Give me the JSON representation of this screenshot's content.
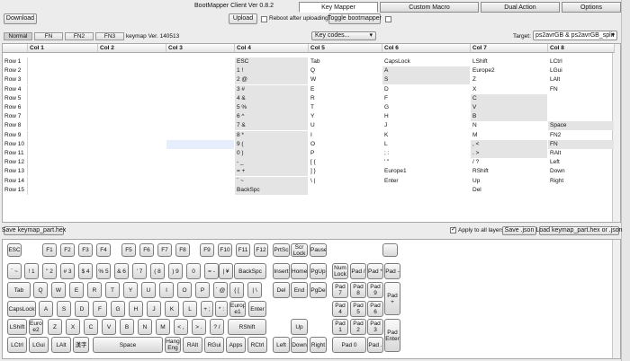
{
  "window": {
    "title": "BootMapper Client Ver 0.8.2"
  },
  "toolbar": {
    "download": "Download",
    "upload": "Upload",
    "reboot_label": "Reboot after uploading",
    "toggle": "Toggle bootmapper"
  },
  "tabs": [
    "Key Mapper",
    "Custom Macro",
    "Dual Action",
    "Options"
  ],
  "active_tab": "Key Mapper",
  "layers": [
    "Normal",
    "FN",
    "FN2",
    "FN3"
  ],
  "keymap_version": "keymap Ver. 140513",
  "keycodes_dropdown": "Key codes...",
  "target": {
    "label": "Target:",
    "value": "ps2avrGB & ps2avrGB_split"
  },
  "grid": {
    "columns": [
      "Col 1",
      "Col 2",
      "Col 3",
      "Col 4",
      "Col 5",
      "Col 6",
      "Col 7",
      "Col 8"
    ],
    "rows": [
      {
        "label": "Row 1",
        "cells": [
          "",
          "",
          "",
          "ESC",
          "Tab",
          "CapsLock",
          "LShift",
          "LCtrl"
        ]
      },
      {
        "label": "Row 2",
        "cells": [
          "",
          "",
          "",
          "1 !",
          "Q",
          "A",
          "Europe2",
          "LGui"
        ]
      },
      {
        "label": "Row 3",
        "cells": [
          "",
          "",
          "",
          "2 @",
          "W",
          "S",
          "Z",
          "LAlt"
        ]
      },
      {
        "label": "Row 4",
        "cells": [
          "",
          "",
          "",
          "3 #",
          "E",
          "D",
          "X",
          "FN"
        ]
      },
      {
        "label": "Row 5",
        "cells": [
          "",
          "",
          "",
          "4 &",
          "R",
          "F",
          "C",
          ""
        ]
      },
      {
        "label": "Row 6",
        "cells": [
          "",
          "",
          "",
          "5 %",
          "T",
          "G",
          "V",
          ""
        ]
      },
      {
        "label": "Row 7",
        "cells": [
          "",
          "",
          "",
          "6 ^",
          "Y",
          "H",
          "B",
          ""
        ]
      },
      {
        "label": "Row 8",
        "cells": [
          "",
          "",
          "",
          "7 &",
          "U",
          "J",
          "N",
          "Space"
        ]
      },
      {
        "label": "Row 9",
        "cells": [
          "",
          "",
          "",
          "8 *",
          "I",
          "K",
          "M",
          "FN2"
        ]
      },
      {
        "label": "Row 10",
        "cells": [
          "",
          "",
          "",
          "9 (",
          "O",
          "L",
          ", <",
          "FN"
        ]
      },
      {
        "label": "Row 11",
        "cells": [
          "",
          "",
          "",
          "0 )",
          "P",
          "; :",
          ". >",
          "RAlt"
        ]
      },
      {
        "label": "Row 12",
        "cells": [
          "",
          "",
          "",
          "- _",
          "[ {",
          "' \"",
          "/ ?",
          "Left"
        ]
      },
      {
        "label": "Row 13",
        "cells": [
          "",
          "",
          "",
          "= +",
          "] }",
          "Europe1",
          "RShift",
          "Down"
        ]
      },
      {
        "label": "Row 14",
        "cells": [
          "",
          "",
          "",
          "` ~",
          "\\ |",
          "Enter",
          "Up",
          "Right"
        ]
      },
      {
        "label": "Row 15",
        "cells": [
          "",
          "",
          "",
          "BackSpc",
          "",
          "",
          "Del",
          ""
        ]
      }
    ]
  },
  "bottom_bar": {
    "save_part": "Save keymap_part.hex",
    "apply_all": "Apply to all layers",
    "save_json": "Save .json",
    "load": "Load keymap_part.hex or .json"
  },
  "keyboard": {
    "keys": [
      {
        "id": "esc",
        "label": "ESC"
      },
      {
        "id": "f1",
        "label": "F1"
      },
      {
        "id": "f2",
        "label": "F2"
      },
      {
        "id": "f3",
        "label": "F3"
      },
      {
        "id": "f4",
        "label": "F4"
      },
      {
        "id": "f5",
        "label": "F5"
      },
      {
        "id": "f6",
        "label": "F6"
      },
      {
        "id": "f7",
        "label": "F7"
      },
      {
        "id": "f8",
        "label": "F8"
      },
      {
        "id": "f9",
        "label": "F9"
      },
      {
        "id": "f10",
        "label": "F10"
      },
      {
        "id": "f11",
        "label": "F11"
      },
      {
        "id": "f12",
        "label": "F12"
      },
      {
        "id": "prtsc",
        "label": "PrtSc"
      },
      {
        "id": "scrlock",
        "label": "Scr Lock"
      },
      {
        "id": "pause",
        "label": "Pause"
      },
      {
        "id": "blank1",
        "label": ""
      },
      {
        "id": "grave",
        "label": "` ~"
      },
      {
        "id": "k1",
        "label": "! 1"
      },
      {
        "id": "k2",
        "label": "\" 2"
      },
      {
        "id": "k3",
        "label": "# 3"
      },
      {
        "id": "k4",
        "label": "$ 4"
      },
      {
        "id": "k5",
        "label": "% 5"
      },
      {
        "id": "k6",
        "label": "& 6"
      },
      {
        "id": "k7",
        "label": "' 7"
      },
      {
        "id": "k8",
        "label": "( 8"
      },
      {
        "id": "k9",
        "label": ") 9"
      },
      {
        "id": "k0",
        "label": "0"
      },
      {
        "id": "minus",
        "label": "= -"
      },
      {
        "id": "caret",
        "label": "~ ^"
      },
      {
        "id": "yen",
        "label": "| ¥"
      },
      {
        "id": "backspc",
        "label": "BackSpc"
      },
      {
        "id": "insert",
        "label": "Insert"
      },
      {
        "id": "home",
        "label": "Home"
      },
      {
        "id": "pgup",
        "label": "PgUp"
      },
      {
        "id": "numlock",
        "label": "Num Lock"
      },
      {
        "id": "padslash",
        "label": "Pad /"
      },
      {
        "id": "padstar",
        "label": "Pad *"
      },
      {
        "id": "padminus",
        "label": "Pad -"
      },
      {
        "id": "tab",
        "label": "Tab"
      },
      {
        "id": "q",
        "label": "Q"
      },
      {
        "id": "w",
        "label": "W"
      },
      {
        "id": "e",
        "label": "E"
      },
      {
        "id": "r",
        "label": "R"
      },
      {
        "id": "t",
        "label": "T"
      },
      {
        "id": "y",
        "label": "Y"
      },
      {
        "id": "u",
        "label": "U"
      },
      {
        "id": "i",
        "label": "I"
      },
      {
        "id": "o",
        "label": "O"
      },
      {
        "id": "p",
        "label": "P"
      },
      {
        "id": "at",
        "label": "` @"
      },
      {
        "id": "lbrace",
        "label": "{ ["
      },
      {
        "id": "rbrace",
        "label": "| \\"
      },
      {
        "id": "del",
        "label": "Del"
      },
      {
        "id": "end",
        "label": "End"
      },
      {
        "id": "pgdn",
        "label": "PgDe"
      },
      {
        "id": "pad7",
        "label": "Pad 7"
      },
      {
        "id": "pad8",
        "label": "Pad 8"
      },
      {
        "id": "pad9",
        "label": "Pad 9"
      },
      {
        "id": "padplus",
        "label": "Pad +"
      },
      {
        "id": "capslock",
        "label": "CapsLock"
      },
      {
        "id": "a",
        "label": "A"
      },
      {
        "id": "s",
        "label": "S"
      },
      {
        "id": "d",
        "label": "D"
      },
      {
        "id": "f",
        "label": "F"
      },
      {
        "id": "g",
        "label": "G"
      },
      {
        "id": "h",
        "label": "H"
      },
      {
        "id": "j",
        "label": "J"
      },
      {
        "id": "k",
        "label": "K"
      },
      {
        "id": "l",
        "label": "L"
      },
      {
        "id": "semicolon",
        "label": "+ ;"
      },
      {
        "id": "colon",
        "label": "* :"
      },
      {
        "id": "europe1",
        "label": "Europ e1"
      },
      {
        "id": "enter",
        "label": "Enter"
      },
      {
        "id": "pad4",
        "label": "Pad 4"
      },
      {
        "id": "pad5",
        "label": "Pad 5"
      },
      {
        "id": "pad6",
        "label": "Pad 6"
      },
      {
        "id": "lshift",
        "label": "LShift"
      },
      {
        "id": "europe2",
        "label": "Europ e2"
      },
      {
        "id": "z",
        "label": "Z"
      },
      {
        "id": "x",
        "label": "X"
      },
      {
        "id": "c",
        "label": "C"
      },
      {
        "id": "v",
        "label": "V"
      },
      {
        "id": "b",
        "label": "B"
      },
      {
        "id": "n",
        "label": "N"
      },
      {
        "id": "m",
        "label": "M"
      },
      {
        "id": "comma",
        "label": "< ,"
      },
      {
        "id": "period",
        "label": "> ."
      },
      {
        "id": "slash",
        "label": "? /"
      },
      {
        "id": "ro",
        "label": "_ \\"
      },
      {
        "id": "rshift",
        "label": "RShift"
      },
      {
        "id": "up",
        "label": "Up"
      },
      {
        "id": "pad1",
        "label": "Pad 1"
      },
      {
        "id": "pad2",
        "label": "Pad 2"
      },
      {
        "id": "pad3",
        "label": "Pad 3"
      },
      {
        "id": "padenter",
        "label": "Pad Enter"
      },
      {
        "id": "lctrl",
        "label": "LCtrl"
      },
      {
        "id": "lgui",
        "label": "LGui"
      },
      {
        "id": "lalt",
        "label": "LAlt"
      },
      {
        "id": "kanji",
        "label": "漢字"
      },
      {
        "id": "space",
        "label": "Space"
      },
      {
        "id": "hangeng",
        "label": "Hang Eng"
      },
      {
        "id": "ralt",
        "label": "RAlt"
      },
      {
        "id": "rgui",
        "label": "RGui"
      },
      {
        "id": "apps",
        "label": "Apps"
      },
      {
        "id": "rctrl",
        "label": "RCtrl"
      },
      {
        "id": "left",
        "label": "Left"
      },
      {
        "id": "down",
        "label": "Down"
      },
      {
        "id": "right",
        "label": "Right"
      },
      {
        "id": "pad0",
        "label": "Pad 0"
      },
      {
        "id": "paddot",
        "label": "Pad ."
      }
    ]
  }
}
